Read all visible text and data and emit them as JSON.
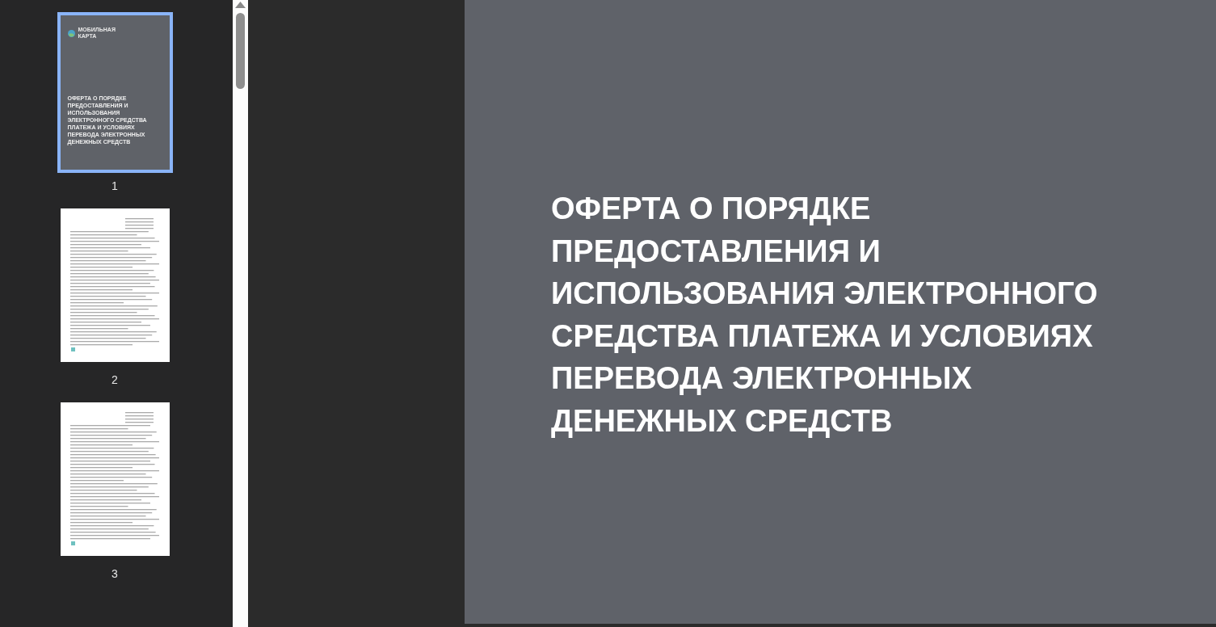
{
  "thumbnails": [
    {
      "kind": "cover",
      "page_label": "1",
      "selected": true,
      "logo_text": "МОБИЛЬНАЯ КАРТА",
      "title": "ОФЕРТА О ПОРЯДКЕ ПРЕДОСТАВЛЕНИЯ И ИСПОЛЬЗОВАНИЯ ЭЛЕКТРОННОГО СРЕДСТВА ПЛАТЕЖА И УСЛОВИЯХ ПЕРЕВОДА ЭЛЕКТРОННЫХ ДЕНЕЖНЫХ СРЕДСТВ"
    },
    {
      "kind": "text",
      "page_label": "2",
      "selected": false
    },
    {
      "kind": "text",
      "page_label": "3",
      "selected": false
    }
  ],
  "page": {
    "title_lines": [
      "ОФЕРТА О ПОРЯДКЕ",
      "ПРЕДОСТАВЛЕНИЯ И",
      "ИСПОЛЬЗОВАНИЯ ЭЛЕКТРОННОГО",
      "СРЕДСТВА ПЛАТЕЖА И УСЛОВИЯХ",
      "ПЕРЕВОДА ЭЛЕКТРОННЫХ",
      "ДЕНЕЖНЫХ СРЕДСТВ"
    ]
  }
}
